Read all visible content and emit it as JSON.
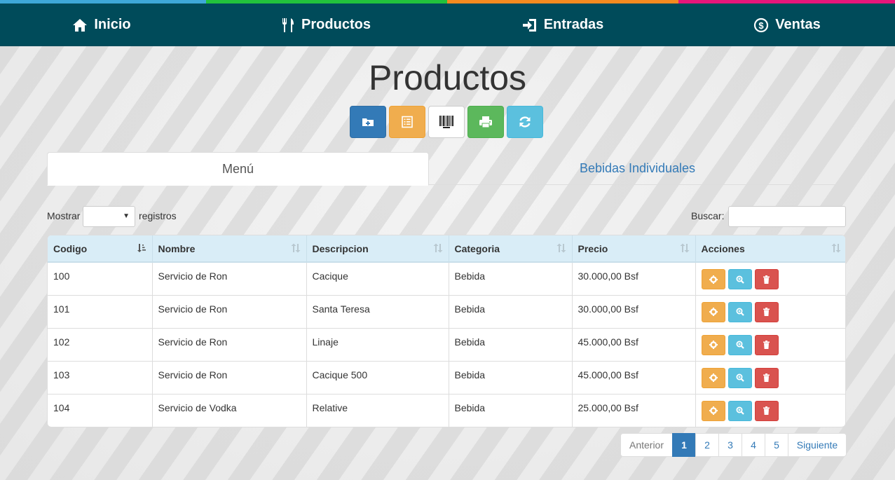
{
  "nav": {
    "items": [
      {
        "label": "Inicio",
        "icon": "home-icon"
      },
      {
        "label": "Productos",
        "icon": "cutlery-icon"
      },
      {
        "label": "Entradas",
        "icon": "log-in-icon"
      },
      {
        "label": "Ventas",
        "icon": "dollar-circle-icon"
      }
    ],
    "stripe_colors": [
      "#3ea8d8",
      "#22c23c",
      "#f58a1f",
      "#e6167a"
    ],
    "background": "#004b5a"
  },
  "page": {
    "title": "Productos"
  },
  "toolbar": {
    "buttons": [
      {
        "name": "new-product-button",
        "icon": "folder-plus-icon",
        "color": "#337ab7"
      },
      {
        "name": "list-button",
        "icon": "list-alt-icon",
        "color": "#f0ad4e"
      },
      {
        "name": "barcode-button",
        "icon": "barcode-icon",
        "color": "#ffffff"
      },
      {
        "name": "print-button",
        "icon": "print-icon",
        "color": "#5cb85c"
      },
      {
        "name": "refresh-button",
        "icon": "refresh-icon",
        "color": "#5bc0de"
      }
    ]
  },
  "tabs": [
    {
      "label": "Menú",
      "active": true
    },
    {
      "label": "Bebidas Individuales",
      "active": false
    }
  ],
  "length": {
    "prefix": "Mostrar",
    "suffix": "registros",
    "selected": ""
  },
  "search": {
    "label": "Buscar:",
    "value": ""
  },
  "table": {
    "columns": [
      "Codigo",
      "Nombre",
      "Descripcion",
      "Categoria",
      "Precio",
      "Acciones"
    ],
    "rows": [
      [
        "100",
        "Servicio de Ron",
        "Cacique",
        "Bebida",
        "30.000,00 Bsf"
      ],
      [
        "101",
        "Servicio de Ron",
        "Santa Teresa",
        "Bebida",
        "30.000,00 Bsf"
      ],
      [
        "102",
        "Servicio de Ron",
        "Linaje",
        "Bebida",
        "45.000,00 Bsf"
      ],
      [
        "103",
        "Servicio de Ron",
        "Cacique 500",
        "Bebida",
        "45.000,00 Bsf"
      ],
      [
        "104",
        "Servicio de Vodka",
        "Relative",
        "Bebida",
        "25.000,00 Bsf"
      ]
    ],
    "row_actions": [
      "settings-icon",
      "zoom-in-icon",
      "trash-icon"
    ]
  },
  "pagination": {
    "previous": "Anterior",
    "pages": [
      "1",
      "2",
      "3",
      "4",
      "5"
    ],
    "current": "1",
    "next": "Siguiente"
  }
}
